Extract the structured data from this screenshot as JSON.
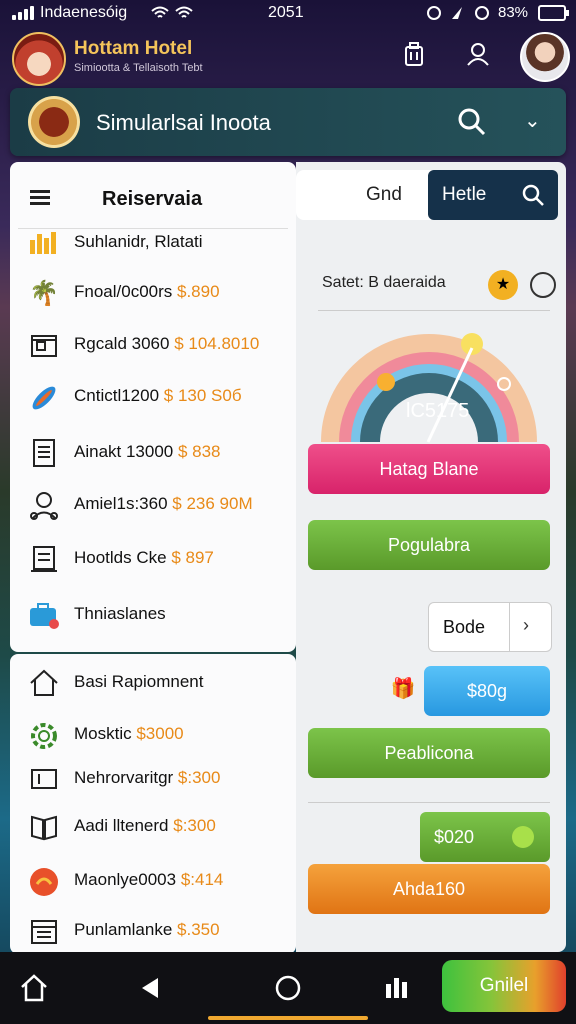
{
  "status": {
    "carrier": "Indaenesóig",
    "time": "2051",
    "battery": "83%"
  },
  "header": {
    "title": "Hottam Hotel",
    "subtitle": "Simiootta & Tellaisoth Tebt"
  },
  "search_bar": {
    "title": "Simularlsai Inoota"
  },
  "reservation": {
    "title": "Reiservaia",
    "items": [
      {
        "label": "Suhlanidr, Rlatati",
        "price": "",
        "icon": "chart-icon"
      },
      {
        "label": "Fnoal/0c00rs ",
        "price": "$.890",
        "icon": "palm-tree-icon"
      },
      {
        "label": "Rgcald 3060 ",
        "price": "$ 104.8010",
        "icon": "room-icon"
      },
      {
        "label": "Cntictl1200 ",
        "price": "$ 130 S0б",
        "icon": "surfboard-icon"
      },
      {
        "label": "Ainakt 13000 ",
        "price": "$ 838",
        "icon": "document-icon"
      },
      {
        "label": "Amiel1s:360 ",
        "price": "$ 236 90M",
        "icon": "people-icon"
      },
      {
        "label": "Hootlds Cke ",
        "price": "$ 897",
        "icon": "receipt-icon"
      },
      {
        "label": "Thniaslanes",
        "price": "",
        "icon": "toolbox-icon"
      }
    ]
  },
  "second_list": {
    "items": [
      {
        "label": "Basi Rapiomnent",
        "price": "",
        "icon": "home-icon"
      },
      {
        "label": "Mosktic ",
        "price": "$3000",
        "icon": "gear-icon"
      },
      {
        "label": "Nehrorvaritgr ",
        "price": "$:300",
        "icon": "folder-icon"
      },
      {
        "label": "Aadi lltenerd ",
        "price": "$:300",
        "icon": "book-icon"
      },
      {
        "label": "Maonlye0003 ",
        "price": "$:414",
        "icon": "shell-icon"
      },
      {
        "label": "Punlamlanke ",
        "price": "$.350",
        "icon": "calendar-icon"
      }
    ]
  },
  "tabs": {
    "left": "Gnd",
    "right": "Hetle"
  },
  "gauge": {
    "title": "Satet: B daeraida",
    "value": "lC5175"
  },
  "buttons": {
    "pink": "Hatag Blane",
    "green1": "Pogulabra",
    "pill": "Bode",
    "blue": "$80g",
    "green2": "Peablicona",
    "green3": "$020",
    "orange": "Ahda160"
  },
  "nav": {
    "cta": "Gnilel"
  },
  "colors": {
    "accent_gold": "#f4c45a",
    "price_orange": "#e88a18",
    "header_teal": "#1b3c46"
  }
}
